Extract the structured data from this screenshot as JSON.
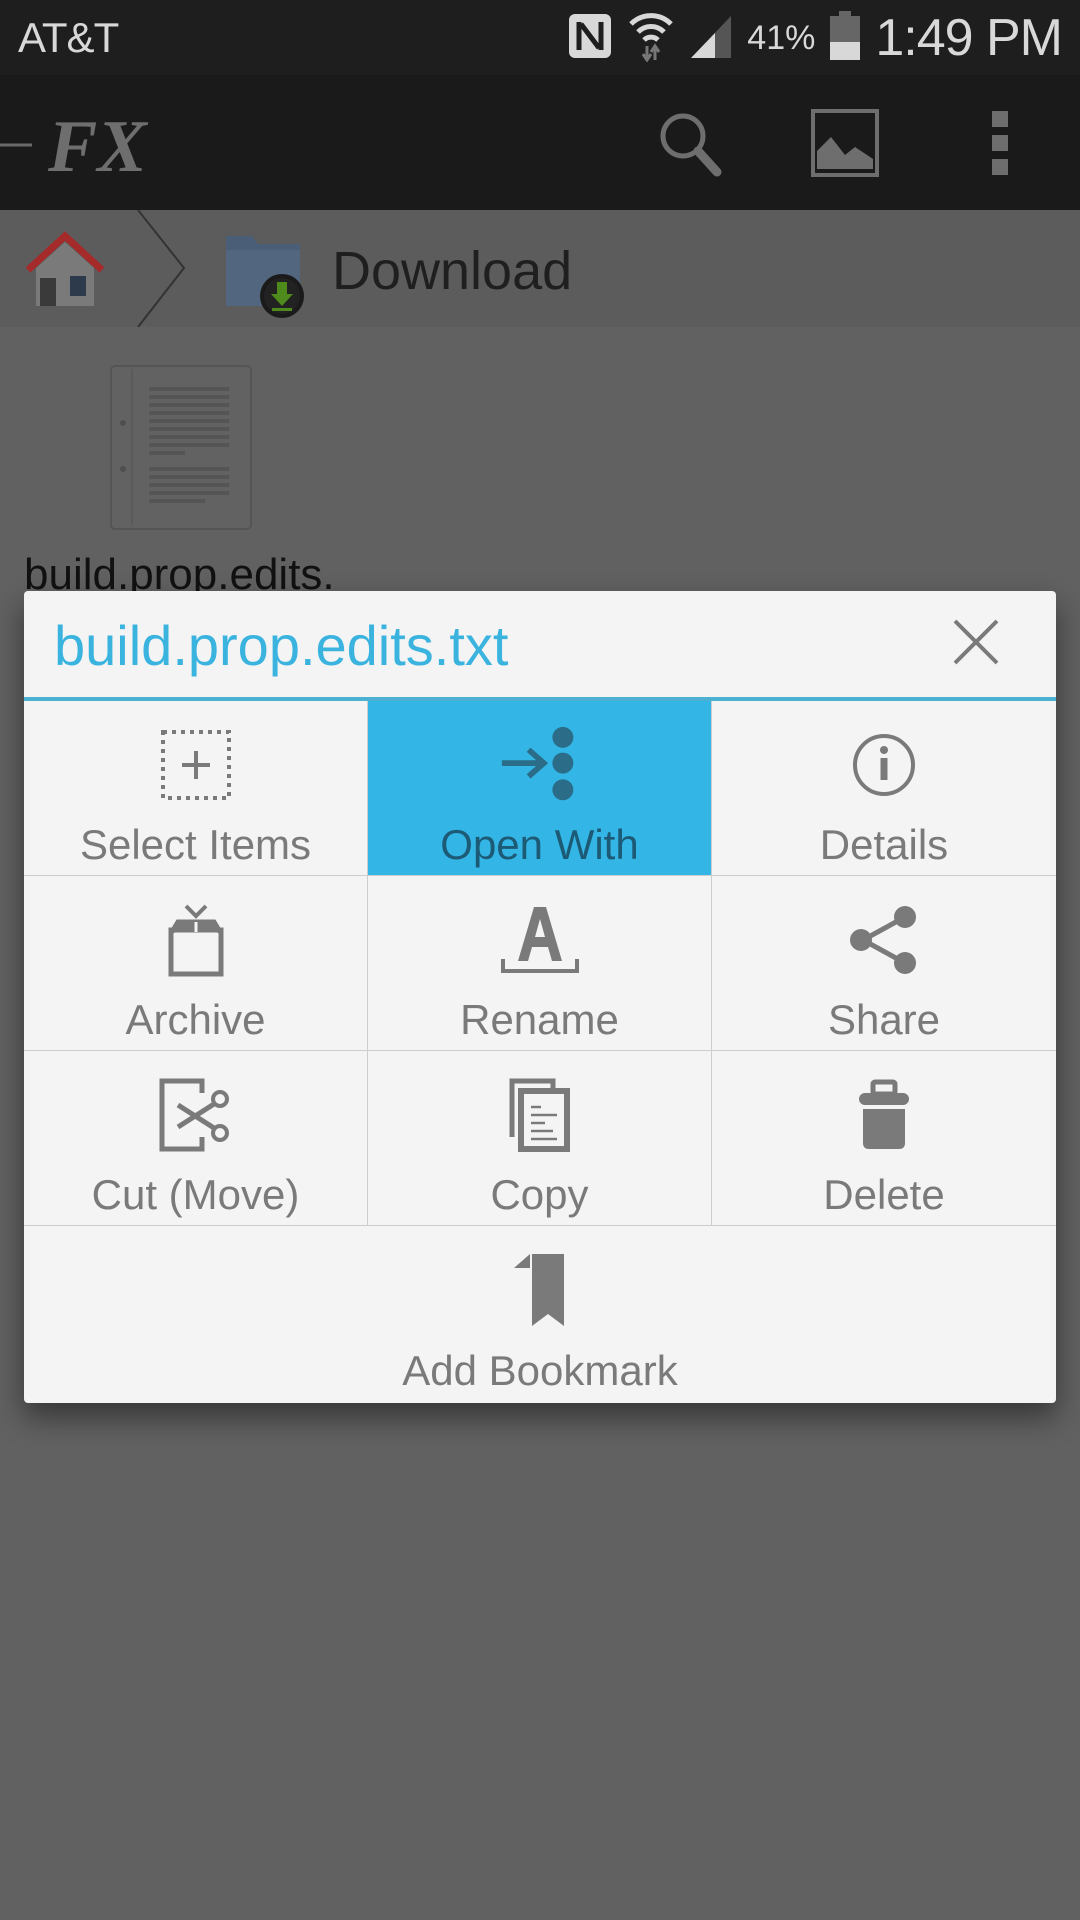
{
  "status_bar": {
    "carrier": "AT&T",
    "battery_percent": "41%",
    "battery_level": 0.41,
    "time": "1:49 PM",
    "icons": [
      "nfc-icon",
      "wifi-icon",
      "signal-icon",
      "battery-icon"
    ]
  },
  "toolbar": {
    "logo": "FX",
    "actions": [
      "search-icon",
      "gallery-icon",
      "overflow-menu-icon"
    ]
  },
  "breadcrumb": {
    "items": [
      {
        "label": "",
        "icon": "home-icon"
      },
      {
        "label": "Download",
        "icon": "download-folder-icon"
      }
    ]
  },
  "files": [
    {
      "name": "build.prop.edits.",
      "icon": "text-document-icon"
    }
  ],
  "dialog": {
    "title": "build.prop.edits.txt",
    "close_icon": "close-icon",
    "accent_color": "#33b5e5",
    "actions": [
      {
        "label": "Select Items",
        "icon": "select-items-icon",
        "active": false
      },
      {
        "label": "Open With",
        "icon": "open-with-icon",
        "active": true
      },
      {
        "label": "Details",
        "icon": "info-icon",
        "active": false
      },
      {
        "label": "Archive",
        "icon": "archive-icon",
        "active": false
      },
      {
        "label": "Rename",
        "icon": "rename-icon",
        "active": false
      },
      {
        "label": "Share",
        "icon": "share-icon",
        "active": false
      },
      {
        "label": "Cut (Move)",
        "icon": "cut-icon",
        "active": false
      },
      {
        "label": "Copy",
        "icon": "copy-icon",
        "active": false
      },
      {
        "label": "Delete",
        "icon": "trash-icon",
        "active": false
      },
      {
        "label": "Add Bookmark",
        "icon": "bookmark-icon",
        "active": false
      }
    ]
  }
}
